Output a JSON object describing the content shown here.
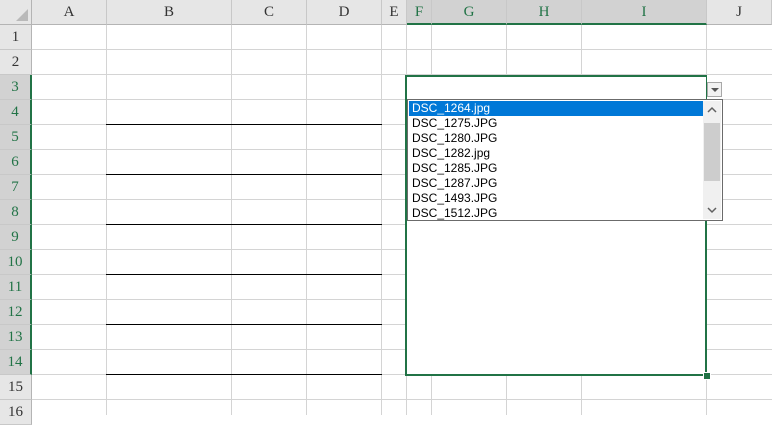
{
  "columns": [
    "A",
    "B",
    "C",
    "D",
    "E",
    "F",
    "G",
    "H",
    "I",
    "J"
  ],
  "rows": [
    "1",
    "2",
    "3",
    "4",
    "5",
    "6",
    "7",
    "8",
    "9",
    "10",
    "11",
    "12",
    "13",
    "14",
    "15",
    "16"
  ],
  "dropdown": {
    "items": [
      "DSC_1264.jpg",
      "DSC_1275.JPG",
      "DSC_1280.JPG",
      "DSC_1282.jpg",
      "DSC_1285.JPG",
      "DSC_1287.JPG",
      "DSC_1493.JPG",
      "DSC_1512.JPG"
    ],
    "selected": "DSC_1264.jpg",
    "button_icon": "chevron-down-icon"
  },
  "colors": {
    "accent": "#217346",
    "selection": "#0078d7",
    "gridline": "#d4d4d4"
  }
}
